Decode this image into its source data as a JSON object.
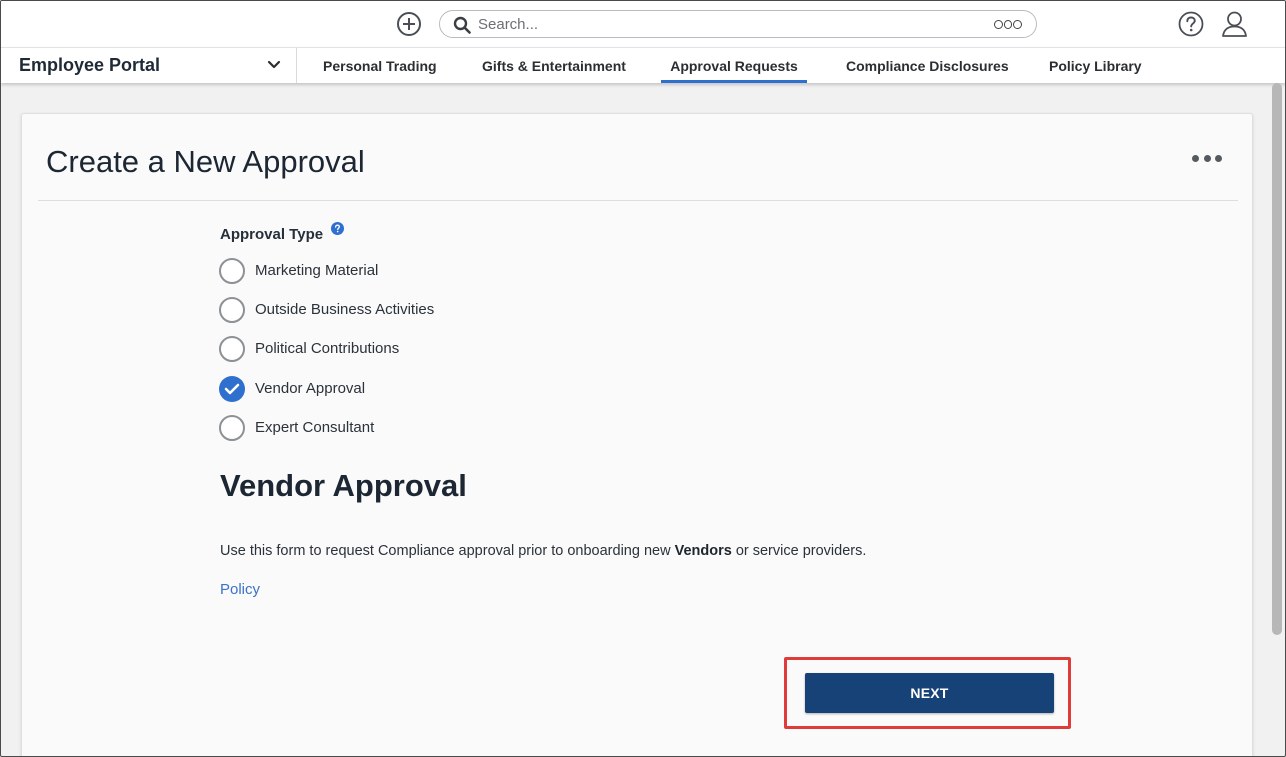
{
  "topbar": {
    "search_placeholder": "Search...",
    "add_icon": "plus-circle-icon",
    "help_icon": "question-circle-icon",
    "user_icon": "user-icon"
  },
  "nav": {
    "portal_name": "Employee Portal",
    "tabs": [
      {
        "label": "Personal Trading",
        "active": false
      },
      {
        "label": "Gifts & Entertainment",
        "active": false
      },
      {
        "label": "Approval Requests",
        "active": true
      },
      {
        "label": "Compliance Disclosures",
        "active": false
      },
      {
        "label": "Policy Library",
        "active": false
      }
    ]
  },
  "card": {
    "title": "Create a New Approval",
    "field_label": "Approval Type",
    "options": [
      {
        "label": "Marketing Material",
        "checked": false
      },
      {
        "label": "Outside Business Activities",
        "checked": false
      },
      {
        "label": "Political Contributions",
        "checked": false
      },
      {
        "label": "Vendor Approval",
        "checked": true
      },
      {
        "label": "Expert Consultant",
        "checked": false
      }
    ],
    "section_title": "Vendor Approval",
    "description_pre": "Use this form to request Compliance approval prior to onboarding new ",
    "description_bold": "Vendors",
    "description_post": " or service providers.",
    "policy_link": "Policy",
    "next_label": "NEXT"
  },
  "colors": {
    "accent": "#2f6fce",
    "primary_button": "#174278",
    "highlight_box": "#e03b3b",
    "link": "#3a73c6"
  }
}
